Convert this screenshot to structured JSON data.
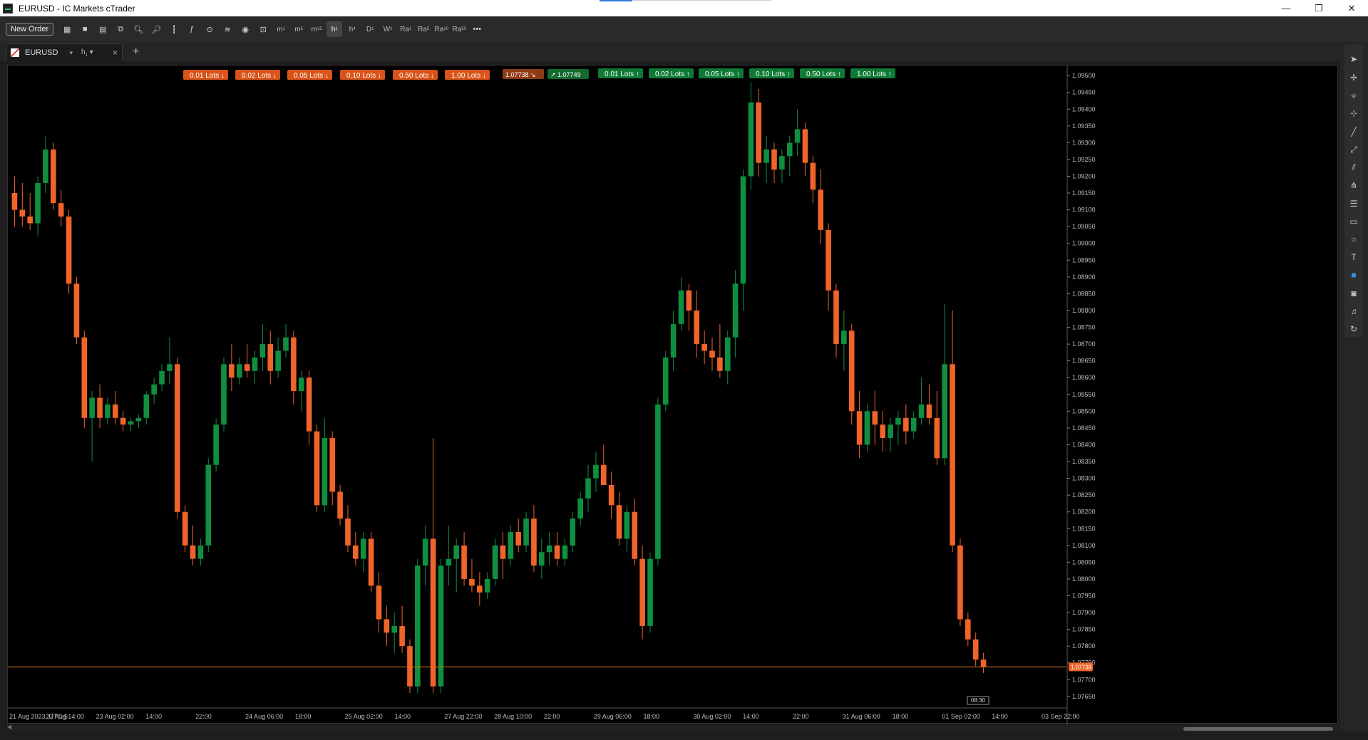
{
  "window": {
    "title": "EURUSD - IC Markets cTrader",
    "minimize": "—",
    "restore": "❐",
    "close": "✕"
  },
  "toolbar": {
    "new_order_label": "New Order",
    "timeframes": [
      {
        "main": "m",
        "sub": "1"
      },
      {
        "main": "m",
        "sub": "5"
      },
      {
        "main": "m",
        "sub": "15"
      },
      {
        "main": "h",
        "sub": "1"
      },
      {
        "main": "h",
        "sub": "4"
      },
      {
        "main": "D",
        "sub": "1"
      },
      {
        "main": "W",
        "sub": "1"
      },
      {
        "main": "Ra",
        "sub": "1"
      },
      {
        "main": "Ra",
        "sub": "5"
      },
      {
        "main": "Ra",
        "sub": "10"
      },
      {
        "main": "Ra",
        "sub": "50"
      }
    ],
    "more_label": "•••"
  },
  "tab": {
    "symbol": "EURUSD",
    "dropdown": "▾",
    "timeframe": "h",
    "timeframe_sub": "1",
    "close": "×",
    "add": "+"
  },
  "trade_buttons": {
    "sell": [
      "0.01 Lots",
      "0.02 Lots",
      "0.05 Lots",
      "0.10 Lots",
      "0.50 Lots",
      "1.00 Lots"
    ],
    "buy": [
      "0.01 Lots",
      "0.02 Lots",
      "0.05 Lots",
      "0.10 Lots",
      "0.50 Lots",
      "1.00 Lots"
    ],
    "bid": "1.07738",
    "ask": "1.07749"
  },
  "chart_data": {
    "type": "candlestick",
    "symbol": "EURUSD",
    "timeframe": "h1",
    "price_axis_ticks": [
      "1.09500",
      "1.09450",
      "1.09400",
      "1.09350",
      "1.09300",
      "1.09250",
      "1.09200",
      "1.09150",
      "1.09100",
      "1.09050",
      "1.09000",
      "1.08950",
      "1.08900",
      "1.08850",
      "1.08800",
      "1.08750",
      "1.08700",
      "1.08650",
      "1.08600",
      "1.08550",
      "1.08500",
      "1.08450",
      "1.08400",
      "1.08350",
      "1.08300",
      "1.08250",
      "1.08200",
      "1.08150",
      "1.08100",
      "1.08050",
      "1.08000",
      "1.07950",
      "1.07900",
      "1.07850",
      "1.07800",
      "1.07750",
      "1.07700",
      "1.07650"
    ],
    "ylim": [
      1.0762,
      1.0953
    ],
    "time_axis_labels": [
      "21 Aug 2023, UTC-5",
      "22 Aug 14:00",
      "23 Aug 02:00",
      "14:00",
      "22:00",
      "24 Aug 06:00",
      "18:00",
      "25 Aug 02:00",
      "14:00",
      "27 Aug 22:00",
      "28 Aug 10:00",
      "22:00",
      "29 Aug 06:00",
      "18:00",
      "30 Aug 02:00",
      "14:00",
      "22:00",
      "31 Aug 06:00",
      "18:00",
      "01 Sep 02:00",
      "14:00",
      "03 Sep 22:00"
    ],
    "current_price": "1.07738",
    "current_price_value": 1.07738,
    "time_cursor_label": "08:30",
    "candles": [
      [
        1.0915,
        1.092,
        1.0905,
        1.091
      ],
      [
        1.091,
        1.0918,
        1.0905,
        1.0908
      ],
      [
        1.0908,
        1.0915,
        1.0904,
        1.0906
      ],
      [
        1.0906,
        1.092,
        1.0902,
        1.0918
      ],
      [
        1.0918,
        1.0932,
        1.0915,
        1.0928
      ],
      [
        1.0928,
        1.093,
        1.091,
        1.0912
      ],
      [
        1.0912,
        1.0916,
        1.0905,
        1.0908
      ],
      [
        1.0908,
        1.091,
        1.0885,
        1.0888
      ],
      [
        1.0888,
        1.089,
        1.087,
        1.0872
      ],
      [
        1.0872,
        1.0874,
        1.0845,
        1.0848
      ],
      [
        1.0848,
        1.0856,
        1.0835,
        1.0854
      ],
      [
        1.0854,
        1.0858,
        1.0845,
        1.0848
      ],
      [
        1.0848,
        1.0854,
        1.0846,
        1.0852
      ],
      [
        1.0852,
        1.0856,
        1.0846,
        1.0848
      ],
      [
        1.0848,
        1.085,
        1.0844,
        1.0846
      ],
      [
        1.0846,
        1.0848,
        1.0844,
        1.0847
      ],
      [
        1.0847,
        1.0849,
        1.0845,
        1.0848
      ],
      [
        1.0848,
        1.0856,
        1.0846,
        1.0855
      ],
      [
        1.0855,
        1.086,
        1.0852,
        1.0858
      ],
      [
        1.0858,
        1.0864,
        1.0856,
        1.0862
      ],
      [
        1.0862,
        1.0872,
        1.0858,
        1.0864
      ],
      [
        1.0864,
        1.0866,
        1.0818,
        1.082
      ],
      [
        1.082,
        1.0822,
        1.0808,
        1.081
      ],
      [
        1.081,
        1.0816,
        1.0804,
        1.0806
      ],
      [
        1.0806,
        1.0812,
        1.0804,
        1.081
      ],
      [
        1.081,
        1.0836,
        1.0808,
        1.0834
      ],
      [
        1.0834,
        1.0848,
        1.0832,
        1.0846
      ],
      [
        1.0846,
        1.0866,
        1.0844,
        1.0864
      ],
      [
        1.0864,
        1.087,
        1.0856,
        1.086
      ],
      [
        1.086,
        1.0866,
        1.0858,
        1.0864
      ],
      [
        1.0864,
        1.087,
        1.086,
        1.0862
      ],
      [
        1.0862,
        1.0868,
        1.0858,
        1.0866
      ],
      [
        1.0866,
        1.0876,
        1.0862,
        1.087
      ],
      [
        1.087,
        1.0874,
        1.0858,
        1.0862
      ],
      [
        1.0862,
        1.0872,
        1.086,
        1.0868
      ],
      [
        1.0868,
        1.0876,
        1.0866,
        1.0872
      ],
      [
        1.0872,
        1.0874,
        1.0852,
        1.0856
      ],
      [
        1.0856,
        1.0862,
        1.085,
        1.086
      ],
      [
        1.086,
        1.0862,
        1.084,
        1.0844
      ],
      [
        1.0844,
        1.0846,
        1.082,
        1.0822
      ],
      [
        1.0822,
        1.0848,
        1.082,
        1.0842
      ],
      [
        1.0842,
        1.0844,
        1.0822,
        1.0826
      ],
      [
        1.0826,
        1.0828,
        1.0816,
        1.0818
      ],
      [
        1.0818,
        1.0822,
        1.0808,
        1.081
      ],
      [
        1.081,
        1.0814,
        1.0804,
        1.0806
      ],
      [
        1.0806,
        1.0814,
        1.0802,
        1.0812
      ],
      [
        1.0812,
        1.0814,
        1.0796,
        1.0798
      ],
      [
        1.0798,
        1.0802,
        1.0784,
        1.0788
      ],
      [
        1.0788,
        1.0792,
        1.078,
        1.0784
      ],
      [
        1.0784,
        1.079,
        1.0778,
        1.0786
      ],
      [
        1.0786,
        1.0792,
        1.0778,
        1.078
      ],
      [
        1.078,
        1.0782,
        1.0766,
        1.0768
      ],
      [
        1.0768,
        1.0806,
        1.0766,
        1.0804
      ],
      [
        1.0804,
        1.0816,
        1.0798,
        1.0812
      ],
      [
        1.0812,
        1.0842,
        1.0766,
        1.0768
      ],
      [
        1.0768,
        1.0806,
        1.0766,
        1.0804
      ],
      [
        1.0804,
        1.0816,
        1.0798,
        1.0806
      ],
      [
        1.0806,
        1.0812,
        1.0796,
        1.081
      ],
      [
        1.081,
        1.0814,
        1.0798,
        1.08
      ],
      [
        1.08,
        1.0806,
        1.0796,
        1.0798
      ],
      [
        1.0798,
        1.0802,
        1.0792,
        1.0796
      ],
      [
        1.0796,
        1.0802,
        1.0794,
        1.08
      ],
      [
        1.08,
        1.0812,
        1.0798,
        1.081
      ],
      [
        1.081,
        1.0814,
        1.08,
        1.0806
      ],
      [
        1.0806,
        1.0816,
        1.0804,
        1.0814
      ],
      [
        1.0814,
        1.0818,
        1.0808,
        1.081
      ],
      [
        1.081,
        1.082,
        1.0808,
        1.0818
      ],
      [
        1.0818,
        1.0822,
        1.0802,
        1.0804
      ],
      [
        1.0804,
        1.0812,
        1.08,
        1.0808
      ],
      [
        1.0808,
        1.0814,
        1.0804,
        1.081
      ],
      [
        1.081,
        1.0814,
        1.0804,
        1.0806
      ],
      [
        1.0806,
        1.0812,
        1.0804,
        1.081
      ],
      [
        1.081,
        1.082,
        1.0808,
        1.0818
      ],
      [
        1.0818,
        1.0826,
        1.0816,
        1.0824
      ],
      [
        1.0824,
        1.0834,
        1.082,
        1.083
      ],
      [
        1.083,
        1.0838,
        1.0826,
        1.0834
      ],
      [
        1.0834,
        1.084,
        1.083,
        1.0828
      ],
      [
        1.0828,
        1.0832,
        1.0818,
        1.0822
      ],
      [
        1.0822,
        1.0826,
        1.081,
        1.0812
      ],
      [
        1.0812,
        1.0822,
        1.0808,
        1.082
      ],
      [
        1.082,
        1.0824,
        1.0804,
        1.0806
      ],
      [
        1.0806,
        1.081,
        1.0782,
        1.0786
      ],
      [
        1.0786,
        1.0808,
        1.0784,
        1.0806
      ],
      [
        1.0806,
        1.0854,
        1.0804,
        1.0852
      ],
      [
        1.0852,
        1.0868,
        1.085,
        1.0866
      ],
      [
        1.0866,
        1.088,
        1.0862,
        1.0876
      ],
      [
        1.0876,
        1.089,
        1.0874,
        1.0886
      ],
      [
        1.0886,
        1.0888,
        1.0874,
        1.088
      ],
      [
        1.088,
        1.0886,
        1.0866,
        1.087
      ],
      [
        1.087,
        1.0874,
        1.0864,
        1.0868
      ],
      [
        1.0868,
        1.0872,
        1.0862,
        1.0866
      ],
      [
        1.0866,
        1.0876,
        1.086,
        1.0862
      ],
      [
        1.0862,
        1.0874,
        1.0858,
        1.0872
      ],
      [
        1.0872,
        1.0892,
        1.0866,
        1.0888
      ],
      [
        1.0888,
        1.0922,
        1.088,
        1.092
      ],
      [
        1.092,
        1.0948,
        1.0916,
        1.0942
      ],
      [
        1.0942,
        1.0946,
        1.092,
        1.0924
      ],
      [
        1.0924,
        1.0932,
        1.0918,
        1.0928
      ],
      [
        1.0928,
        1.093,
        1.0918,
        1.0922
      ],
      [
        1.0922,
        1.0928,
        1.0918,
        1.0926
      ],
      [
        1.0926,
        1.0932,
        1.092,
        1.093
      ],
      [
        1.093,
        1.094,
        1.0926,
        1.0934
      ],
      [
        1.0934,
        1.0936,
        1.092,
        1.0924
      ],
      [
        1.0924,
        1.0926,
        1.0912,
        1.0916
      ],
      [
        1.0916,
        1.0922,
        1.09,
        1.0904
      ],
      [
        1.0904,
        1.0906,
        1.088,
        1.0886
      ],
      [
        1.0886,
        1.0888,
        1.0866,
        1.087
      ],
      [
        1.087,
        1.088,
        1.0862,
        1.0874
      ],
      [
        1.0874,
        1.0876,
        1.0846,
        1.085
      ],
      [
        1.085,
        1.0856,
        1.0836,
        1.084
      ],
      [
        1.084,
        1.0852,
        1.0838,
        1.085
      ],
      [
        1.085,
        1.0856,
        1.084,
        1.0846
      ],
      [
        1.0846,
        1.085,
        1.0838,
        1.0842
      ],
      [
        1.0842,
        1.0848,
        1.0838,
        1.0846
      ],
      [
        1.0846,
        1.085,
        1.084,
        1.0848
      ],
      [
        1.0848,
        1.0852,
        1.084,
        1.0844
      ],
      [
        1.0844,
        1.085,
        1.0842,
        1.0848
      ],
      [
        1.0848,
        1.086,
        1.0846,
        1.0852
      ],
      [
        1.0852,
        1.0858,
        1.0846,
        1.0848
      ],
      [
        1.0848,
        1.0856,
        1.0834,
        1.0836
      ],
      [
        1.0836,
        1.0882,
        1.0834,
        1.0864
      ],
      [
        1.0864,
        1.088,
        1.0808,
        1.081
      ],
      [
        1.081,
        1.0812,
        1.0786,
        1.0788
      ],
      [
        1.0788,
        1.079,
        1.078,
        1.0782
      ],
      [
        1.0782,
        1.0784,
        1.0774,
        1.0776
      ],
      [
        1.0776,
        1.0778,
        1.0772,
        1.07738
      ]
    ]
  }
}
